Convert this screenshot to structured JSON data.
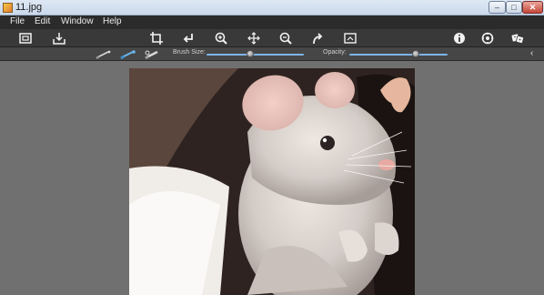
{
  "window": {
    "title": "11.jpg"
  },
  "menu": {
    "file": "File",
    "edit": "Edit",
    "window": "Window",
    "help": "Help"
  },
  "toolbar": {
    "icons": [
      "compare-icon",
      "save-icon",
      "crop-icon",
      "undo-icon",
      "zoom-in-icon",
      "move-icon",
      "zoom-out-icon",
      "redo-icon",
      "fit-icon",
      "info-icon",
      "settings-icon",
      "random-icon"
    ]
  },
  "options": {
    "brush_size_label": "Brush Size:",
    "brush_size_value": 0.45,
    "opacity_label": "Opacity:",
    "opacity_value": 0.68
  },
  "image": {
    "subject": "chinchilla"
  }
}
